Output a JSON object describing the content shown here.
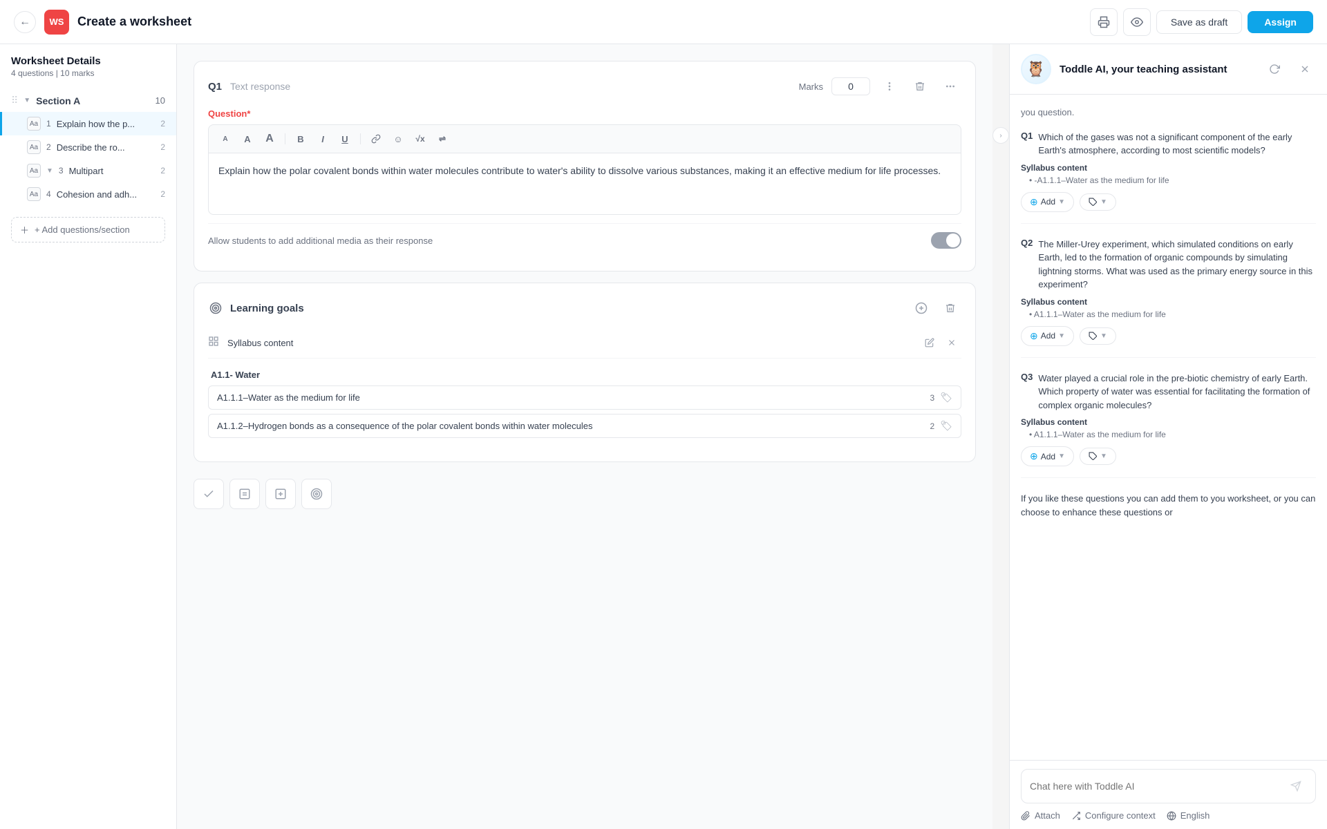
{
  "header": {
    "back_icon": "←",
    "avatar_text": "WS",
    "title": "Create a worksheet",
    "print_icon": "🖨",
    "preview_icon": "👁",
    "save_draft_label": "Save as draft",
    "assign_label": "Assign"
  },
  "sidebar": {
    "worksheet_title": "Worksheet Details",
    "worksheet_subtitle": "4 questions | 10 marks",
    "section_label": "Section A",
    "section_count": "10",
    "add_btn_label": "+ Add questions/section",
    "items": [
      {
        "num": "1",
        "label": "Explain how the p...",
        "marks": "2",
        "active": true
      },
      {
        "num": "2",
        "label": "Describe the ro...",
        "marks": "2",
        "active": false
      },
      {
        "num": "3",
        "label": "Multipart",
        "marks": "2",
        "active": false,
        "has_expand": true
      },
      {
        "num": "4",
        "label": "Cohesion and adh...",
        "marks": "2",
        "active": false
      }
    ]
  },
  "question": {
    "num": "Q1",
    "type": "Text response",
    "marks_label": "Marks",
    "marks_value": "0",
    "question_label": "Question",
    "required": "*",
    "content": "Explain how the polar covalent bonds within water molecules contribute to water's ability to dissolve various substances, making it an effective medium for life processes.",
    "media_toggle_label": "Allow students to add additional media as their response"
  },
  "toolbar": {
    "items": [
      "A",
      "A",
      "A",
      "B",
      "I",
      "U",
      "🔗",
      "😊",
      "√x",
      "⇌"
    ]
  },
  "learning_goals": {
    "section_title": "Learning goals",
    "syllabus_title": "Syllabus content",
    "water_group": "A1.1- Water",
    "items": [
      {
        "label": "A1.1.1–Water as the medium for life",
        "count": "3"
      },
      {
        "label": "A1.1.2–Hydrogen bonds as a consequence of the polar covalent bonds within water  molecules",
        "count": "2"
      }
    ]
  },
  "ai_panel": {
    "avatar_emoji": "🦉",
    "title": "Toddle AI, your teaching assistant",
    "intro_text": "you question.",
    "questions": [
      {
        "num": "Q1",
        "text": "Which of the gases was not a significant component of the early Earth's atmosphere, according to most scientific models?",
        "syllabus_label": "Syllabus content",
        "syllabus_item": "-A1.1.1–Water as the medium for life",
        "add_label": "Add",
        "tag_label": ""
      },
      {
        "num": "Q2",
        "text": "The Miller-Urey experiment, which simulated conditions on early Earth, led to the formation of organic compounds by simulating lightning storms. What was used as the primary energy source in this experiment?",
        "syllabus_label": "Syllabus content",
        "syllabus_item": "A1.1.1–Water as the medium for life",
        "add_label": "Add",
        "tag_label": ""
      },
      {
        "num": "Q3",
        "text": "Water played a crucial role in the pre-biotic chemistry of early Earth. Which property of water was essential for facilitating the formation of complex organic molecules?",
        "syllabus_label": "Syllabus content",
        "syllabus_item": "A1.1.1–Water as the medium for life",
        "add_label": "Add",
        "tag_label": ""
      }
    ],
    "bottom_text": "If you like these questions you can add them to you worksheet, or you can choose to enhance these questions or",
    "chat_placeholder": "Chat here with Toddle AI",
    "send_icon": "▶",
    "attach_label": "Attach",
    "configure_label": "Configure context",
    "language_label": "English"
  }
}
